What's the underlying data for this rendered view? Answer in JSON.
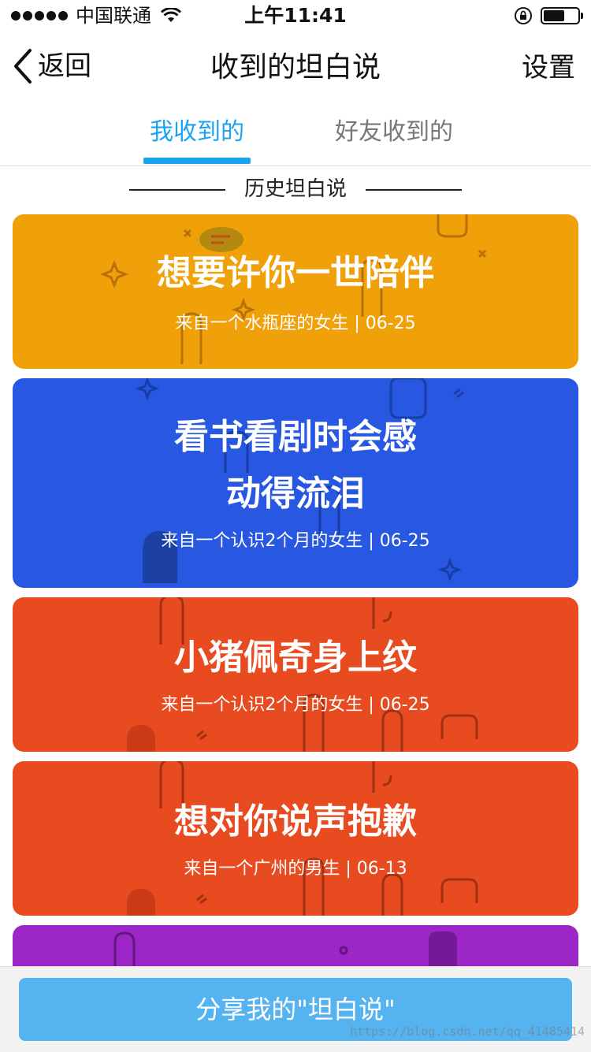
{
  "status_bar": {
    "carrier": "中国联通",
    "time": "上午11:41",
    "battery_level": 0.62
  },
  "nav": {
    "back_label": "返回",
    "title": "收到的坦白说",
    "settings_label": "设置"
  },
  "tabs": [
    {
      "label": "我收到的",
      "active": true
    },
    {
      "label": "好友收到的",
      "active": false
    }
  ],
  "section_title": "历史坦白说",
  "cards": [
    {
      "title": "想要许你一世陪伴",
      "subtitle": "来自一个水瓶座的女生 | 06-25",
      "color": "#f0a10a"
    },
    {
      "title_line1": "看书看剧时会感",
      "title_line2": "动得流泪",
      "subtitle": "来自一个认识2个月的女生 | 06-25",
      "color": "#2858e2"
    },
    {
      "title": "小猪佩奇身上纹",
      "subtitle": "来自一个认识2个月的女生 | 06-25",
      "color": "#e84b1f"
    },
    {
      "title": "想对你说声抱歉",
      "subtitle": "来自一个广州的男生 | 06-13",
      "color": "#e84b1f"
    },
    {
      "color": "#9c26c6"
    }
  ],
  "share_button_label": "分享我的\"坦白说\"",
  "watermark": "https://blog.csdn.net/qq_41485414"
}
